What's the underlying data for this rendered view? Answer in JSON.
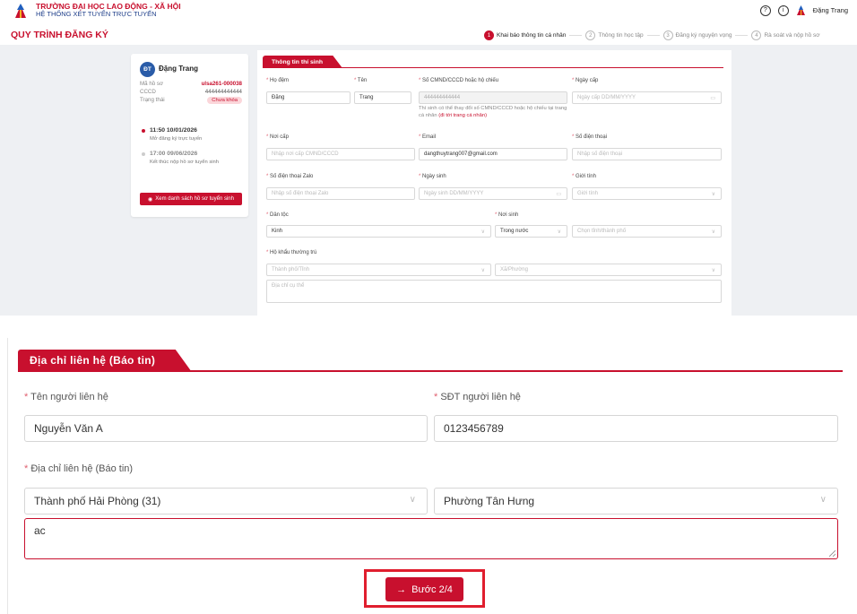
{
  "header": {
    "school_name": "TRƯỜNG ĐẠI HỌC LAO ĐỘNG - XÃ HỘI",
    "system_name": "HỆ THỐNG XÉT TUYỂN TRỰC TUYẾN",
    "user_name": "Đặng Trang"
  },
  "page_title": "QUY TRÌNH ĐĂNG KÝ",
  "steps": [
    {
      "num": "1",
      "label": "Khai báo thông tin cá nhân"
    },
    {
      "num": "2",
      "label": "Thông tin học tập"
    },
    {
      "num": "3",
      "label": "Đăng ký nguyện vọng"
    },
    {
      "num": "4",
      "label": "Rà soát và nộp hồ sơ"
    }
  ],
  "profile": {
    "initials": "ĐT",
    "name": "Đặng Trang",
    "code_label": "Mã hồ sơ",
    "code_value": "ulsa261-000038",
    "cccd_label": "CCCD",
    "cccd_value": "444444444444",
    "status_label": "Trạng thái",
    "status_value": "Chưa khóa",
    "timeline": [
      {
        "time": "11:50 10/01/2026",
        "desc": "Mở đăng ký trực tuyến"
      },
      {
        "time": "17:00 09/06/2026",
        "desc": "Kết thúc nộp hồ sơ tuyển sinh"
      }
    ],
    "list_button": "Xem danh sách hồ sơ tuyển sinh"
  },
  "form": {
    "tab": "Thông tin thí sinh",
    "ho_dem": {
      "label": "Họ đệm",
      "value": "Đặng"
    },
    "ten": {
      "label": "Tên",
      "value": "Trang"
    },
    "cccd": {
      "label": "Số CMND/CCCD hoặc hộ chiếu",
      "value": "444444444444",
      "hint": "Thí sinh có thể thay đổi số CMND/CCCD hoặc hộ chiếu tại trang cá nhân",
      "hint_link": "(đi tới trang cá nhân)"
    },
    "ngay_cap": {
      "label": "Ngày cấp",
      "placeholder": "Ngày cấp DD/MM/YYYY"
    },
    "noi_cap": {
      "label": "Nơi cấp",
      "placeholder": "Nhập nơi cấp CMND/CCCD"
    },
    "email": {
      "label": "Email",
      "value": "dangthuytrang007@gmail.com"
    },
    "sdt": {
      "label": "Số điện thoại",
      "placeholder": "Nhập số điện thoại"
    },
    "zalo": {
      "label": "Số điện thoại Zalo",
      "placeholder": "Nhập số điện thoại Zalo"
    },
    "ngay_sinh": {
      "label": "Ngày sinh",
      "placeholder": "Ngày sinh DD/MM/YYYY"
    },
    "gioi_tinh": {
      "label": "Giới tính",
      "placeholder": "Giới tính"
    },
    "dan_toc": {
      "label": "Dân tộc",
      "value": "Kinh"
    },
    "noi_sinh": {
      "label": "Nơi sinh",
      "value": "Trong nước",
      "province_placeholder": "Chọn tỉnh/thành phố"
    },
    "ho_khau": {
      "label": "Hộ khẩu thường trú",
      "province_placeholder": "Thành phố/Tỉnh",
      "ward_placeholder": "Xã/Phường",
      "address_placeholder": "Địa chỉ cụ thể"
    }
  },
  "contact": {
    "tab": "Địa chỉ liên hệ (Báo tin)",
    "name_label": "Tên người liên hệ",
    "name_value": "Nguyễn Văn A",
    "phone_label": "SĐT người liên hệ",
    "phone_value": "0123456789",
    "address_label": "Địa chỉ liên hệ (Báo tin)",
    "province_value": "Thành phố Hải Phòng (31)",
    "ward_value": "Phường Tân Hưng",
    "address_value": "ac"
  },
  "next_button": "Bước 2/4",
  "colors": {
    "brand_red": "#c8102e",
    "avatar_blue": "#2a5ca8",
    "bg_gray": "#eef0f3"
  }
}
